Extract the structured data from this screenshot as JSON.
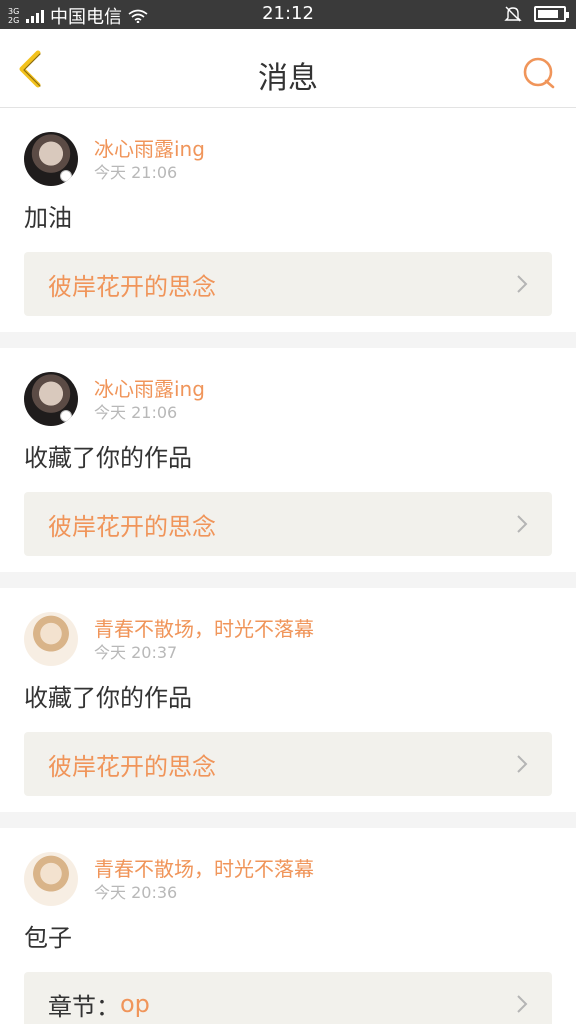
{
  "status_bar": {
    "network_type": "3G 2G",
    "carrier": "中国电信",
    "time": "21:12",
    "battery_level": 0.85
  },
  "header": {
    "title": "消息",
    "back_icon": "chevron-left-icon",
    "search_icon": "search-icon"
  },
  "colors": {
    "accent": "#f0955a",
    "back_arrow": "#f3c21c",
    "card_box": "#f2f1ec"
  },
  "messages": [
    {
      "username": "冰心雨露ing",
      "time": "今天 21:06",
      "content": "加油",
      "work_title": "彼岸花开的思念"
    },
    {
      "username": "冰心雨露ing",
      "time": "今天 21:06",
      "content": "收藏了你的作品",
      "work_title": "彼岸花开的思念"
    },
    {
      "username": "青春不散场，时光不落幕",
      "time": "今天 20:37",
      "content": "收藏了你的作品",
      "work_title": "彼岸花开的思念"
    },
    {
      "username": "青春不散场，时光不落幕",
      "time": "今天 20:36",
      "content": "包子",
      "work_prefix": "章节：",
      "work_value": "op"
    }
  ]
}
